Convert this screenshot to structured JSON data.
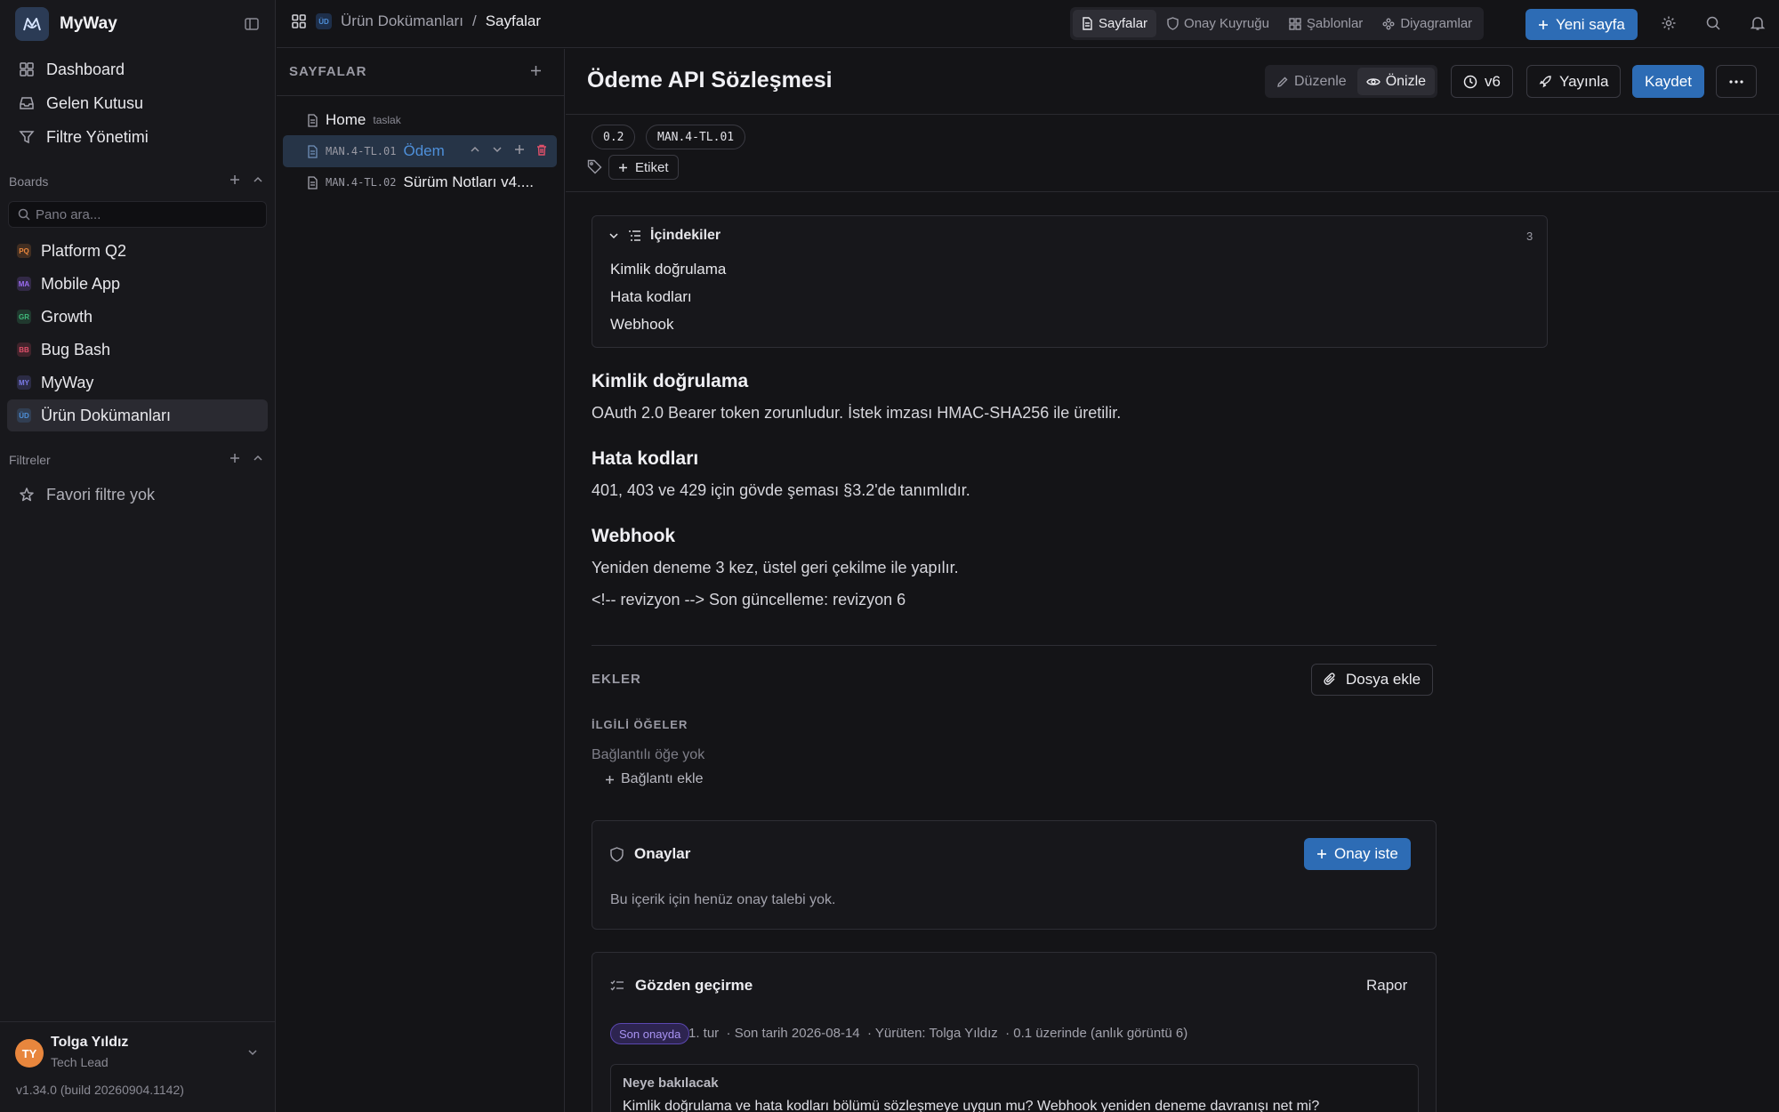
{
  "app": {
    "name": "MyWay"
  },
  "nav": [
    {
      "label": "Dashboard",
      "icon": "grid-icon"
    },
    {
      "label": "Gelen Kutusu",
      "icon": "inbox-icon"
    },
    {
      "label": "Filtre Yönetimi",
      "icon": "filter-icon"
    }
  ],
  "boards": {
    "title": "Boards",
    "search_placeholder": "Pano ara...",
    "items": [
      {
        "abbr": "PQ",
        "label": "Platform Q2",
        "color": "#e8863d"
      },
      {
        "abbr": "MA",
        "label": "Mobile App",
        "color": "#9b6cf0"
      },
      {
        "abbr": "GR",
        "label": "Growth",
        "color": "#3fb97a"
      },
      {
        "abbr": "BB",
        "label": "Bug Bash",
        "color": "#e0506a"
      },
      {
        "abbr": "MY",
        "label": "MyWay",
        "color": "#7a7ae8"
      },
      {
        "abbr": "ÜD",
        "label": "Ürün Dokümanları",
        "color": "#4e8fd9",
        "active": true
      }
    ]
  },
  "filters": {
    "title": "Filtreler",
    "empty": "Favori filtre yok"
  },
  "user": {
    "initials": "TY",
    "name": "Tolga Yıldız",
    "role": "Tech Lead"
  },
  "version": "v1.34.0 (build 20260904.1142)",
  "topbar": {
    "board_badge": "ÜD",
    "breadcrumb_board": "Ürün Dokümanları",
    "breadcrumb_sep": "/",
    "breadcrumb_current": "Sayfalar",
    "tabs": [
      "Sayfalar",
      "Onay Kuyruğu",
      "Şablonlar",
      "Diyagramlar"
    ],
    "new_page": "Yeni sayfa"
  },
  "tree": {
    "title": "SAYFALAR",
    "rows": [
      {
        "code": "",
        "title": "Home",
        "tag": "taslak"
      },
      {
        "code": "MAN.4-TL.01",
        "title": "Ödem",
        "tag": ""
      },
      {
        "code": "MAN.4-TL.02",
        "title": "Sürüm Notları v4....",
        "tag": ""
      }
    ]
  },
  "doc": {
    "title": "Ödeme API Sözleşmesi",
    "mode_edit": "Düzenle",
    "mode_preview": "Önizle",
    "version": "v6",
    "publish": "Yayınla",
    "save": "Kaydet",
    "pills": [
      "0.2",
      "MAN.4-TL.01"
    ],
    "tag_add": "Etiket",
    "toc": {
      "title": "İçindekiler",
      "count": "3",
      "items": [
        "Kimlik doğrulama",
        "Hata kodları",
        "Webhook"
      ]
    },
    "sections": [
      {
        "heading": "Kimlik doğrulama",
        "body": "OAuth 2.0 Bearer token zorunludur. İstek imzası HMAC-SHA256 ile üretilir."
      },
      {
        "heading": "Hata kodları",
        "body": "401, 403 ve 429 için gövde şeması §3.2'de tanımlıdır."
      },
      {
        "heading": "Webhook",
        "body": "Yeniden deneme 3 kez, üstel geri çekilme ile yapılır."
      }
    ],
    "revision_note": "<!-- revizyon --> Son güncelleme: revizyon 6",
    "attachments": {
      "label": "EKLER",
      "add": "Dosya ekle"
    },
    "related": {
      "label": "İLGİLİ ÖĞELER",
      "empty": "Bağlantılı öğe yok",
      "add": "Bağlantı ekle"
    },
    "approvals": {
      "title": "Onaylar",
      "button": "Onay iste",
      "empty": "Bu içerik için henüz onay talebi yok."
    },
    "review": {
      "title": "Gözden geçirme",
      "report": "Rapor",
      "status": "Son onayda",
      "round": "1. tur",
      "due": "· Son tarih 2026-08-14",
      "owner": "· Yürüten: Tolga Yıldız",
      "base": "· 0.1 üzerinde (anlık görüntü 6)",
      "focus_title": "Neye bakılacak",
      "focus_text": "Kimlik doğrulama ve hata kodları bölümü sözleşmeye uygun mu? Webhook yeniden deneme davranışı net mi?"
    }
  },
  "colors": {
    "accent": "#2d6cb5",
    "link": "#4e8fd9",
    "danger": "#e0506a"
  }
}
